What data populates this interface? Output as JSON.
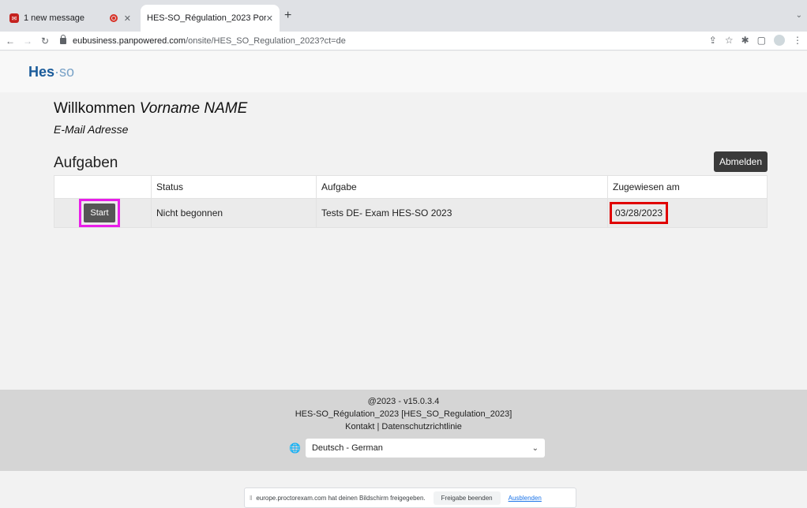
{
  "browser": {
    "tabs": [
      {
        "title": "1 new message",
        "favicon": "mail-badge-icon"
      },
      {
        "title": "HES-SO_Régulation_2023 Por",
        "active": true
      }
    ],
    "new_tab": "+",
    "url_domain": "eubusiness.panpowered.com",
    "url_path": "/onsite/HES_SO_Regulation_2023?ct=de"
  },
  "header": {
    "logo_main": "Hes",
    "logo_sep": "·",
    "logo_sub": "so"
  },
  "welcome": {
    "greeting": "Willkommen",
    "name": "Vorname NAME",
    "email": "E-Mail Adresse"
  },
  "tasks": {
    "title": "Aufgaben",
    "logout_label": "Abmelden",
    "columns": [
      "",
      "Status",
      "Aufgabe",
      "Zugewiesen am"
    ],
    "rows": [
      {
        "action": "Start",
        "status": "Nicht begonnen",
        "task": "Tests DE- Exam HES-SO 2023",
        "assigned": "03/28/2023"
      }
    ]
  },
  "footer": {
    "version": "@2023 - v15.0.3.4",
    "project": "HES-SO_Régulation_2023 [HES_SO_Regulation_2023]",
    "links": "Kontakt | Datenschutzrichtlinie",
    "language": "Deutsch - German"
  },
  "share_bar": {
    "message": "europe.proctorexam.com hat deinen Bildschirm freigegeben.",
    "stop_label": "Freigabe beenden",
    "hide_label": "Ausblenden"
  },
  "colors": {
    "highlight_start": "#e91ee9",
    "highlight_date": "#e00000",
    "logo_blue": "#1a5b9a"
  }
}
